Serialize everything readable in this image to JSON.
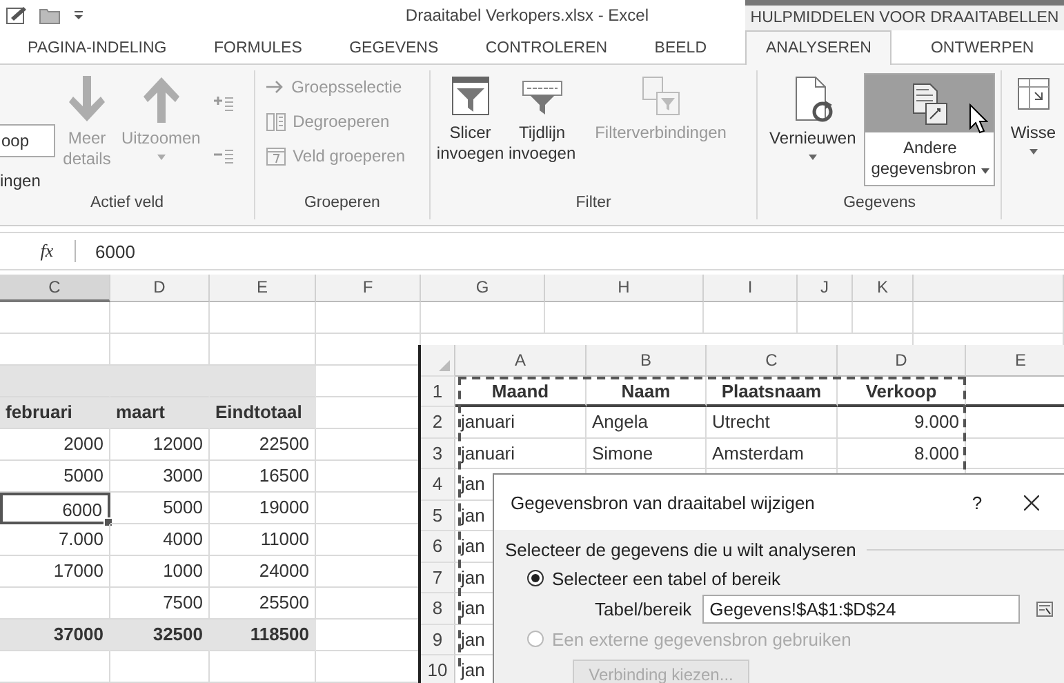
{
  "title_bar": {
    "title": "Draaitabel Verkopers.xlsx - Excel"
  },
  "tabs": [
    {
      "label": "PAGINA-INDELING",
      "selected": false
    },
    {
      "label": "FORMULES",
      "selected": false
    },
    {
      "label": "GEGEVENS",
      "selected": false
    },
    {
      "label": "CONTROLEREN",
      "selected": false
    },
    {
      "label": "BEELD",
      "selected": false
    }
  ],
  "context_tab_group": {
    "title": "HULPMIDDELEN VOOR DRAAITABELLEN",
    "tabs": [
      {
        "label": "ANALYSEREN",
        "selected": true
      },
      {
        "label": "ONTWERPEN",
        "selected": false
      }
    ]
  },
  "ribbon": {
    "active_field": {
      "label": "Actief veld",
      "field_value": "oop",
      "caption": "ingen",
      "drill_down": {
        "label": "Meer details",
        "disabled": true
      },
      "drill_up": {
        "label": "Uitzoomen",
        "disabled": true
      }
    },
    "group": {
      "label": "Groeperen",
      "items": [
        {
          "label": "Groepsselectie",
          "disabled": true
        },
        {
          "label": "Degroeperen",
          "disabled": true
        },
        {
          "label": "Veld groeperen",
          "disabled": true
        }
      ]
    },
    "filter": {
      "label": "Filter",
      "commands": [
        {
          "label": "Slicer invoegen",
          "disabled": false
        },
        {
          "label": "Tijdlijn invoegen",
          "disabled": false
        },
        {
          "label": "Filterverbindingen",
          "disabled": true
        }
      ]
    },
    "data": {
      "label": "Gegevens",
      "refresh": {
        "label": "Vernieuwen"
      },
      "change_source": {
        "label": "Andere gegevensbron",
        "hovered": true
      }
    },
    "clear": {
      "label": "Wisse"
    }
  },
  "formula_bar": {
    "function_label": "fx",
    "value": "6000"
  },
  "sheet": {
    "columns": [
      {
        "label": "C",
        "selected": true
      },
      {
        "label": "D",
        "selected": false
      },
      {
        "label": "E",
        "selected": false
      },
      {
        "label": "F",
        "selected": false
      },
      {
        "label": "G",
        "selected": false
      },
      {
        "label": "H",
        "selected": false
      },
      {
        "label": "I",
        "selected": false
      },
      {
        "label": "J",
        "selected": false
      },
      {
        "label": "K",
        "selected": false
      }
    ],
    "rows": [
      {
        "kind": "blank"
      },
      {
        "kind": "blank"
      },
      {
        "kind": "band"
      },
      {
        "kind": "header",
        "cells": [
          {
            "text": "februari",
            "selected": false
          },
          {
            "text": "maart",
            "selected": false
          },
          {
            "text": "Eindtotaal",
            "selected": false
          }
        ]
      },
      {
        "kind": "data",
        "cells": [
          {
            "text": "2000",
            "selected": false
          },
          {
            "text": "12000",
            "selected": false
          },
          {
            "text": "22500",
            "selected": false
          }
        ]
      },
      {
        "kind": "data",
        "cells": [
          {
            "text": "5000",
            "selected": false
          },
          {
            "text": "3000",
            "selected": false
          },
          {
            "text": "16500",
            "selected": false
          }
        ]
      },
      {
        "kind": "data",
        "cells": [
          {
            "text": "6000",
            "selected": true
          },
          {
            "text": "5000",
            "selected": false
          },
          {
            "text": "19000",
            "selected": false
          }
        ]
      },
      {
        "kind": "data",
        "cells": [
          {
            "text": "7.000",
            "selected": false
          },
          {
            "text": "4000",
            "selected": false
          },
          {
            "text": "11000",
            "selected": false
          }
        ]
      },
      {
        "kind": "data",
        "cells": [
          {
            "text": "17000",
            "selected": false
          },
          {
            "text": "1000",
            "selected": false
          },
          {
            "text": "24000",
            "selected": false
          }
        ]
      },
      {
        "kind": "data",
        "cells": [
          {
            "selected": false
          },
          {
            "text": "7500",
            "selected": false
          },
          {
            "text": "25500",
            "selected": false
          }
        ]
      },
      {
        "kind": "total",
        "cells": [
          {
            "text": "37000",
            "selected": false
          },
          {
            "text": "32500",
            "selected": false
          },
          {
            "text": "118500",
            "selected": false
          }
        ]
      },
      {
        "kind": "blank"
      }
    ]
  },
  "source_sheet": {
    "columns": [
      "A",
      "B",
      "C",
      "D",
      "E"
    ],
    "rows": [
      {
        "number": "1",
        "kind": "header",
        "cells": [
          "Maand",
          "Naam",
          "Plaatsnaam",
          "Verkoop"
        ]
      },
      {
        "number": "2",
        "kind": "data",
        "cells": [
          "januari",
          "Angela",
          "Utrecht",
          "9.000"
        ]
      },
      {
        "number": "3",
        "kind": "data",
        "cells": [
          "januari",
          "Simone",
          "Amsterdam",
          "8.000"
        ]
      },
      {
        "number": "4",
        "kind": "data",
        "cells": [
          "jan"
        ]
      },
      {
        "number": "5",
        "kind": "data",
        "cells": [
          "jan"
        ]
      },
      {
        "number": "6",
        "kind": "data",
        "cells": [
          "jan"
        ]
      },
      {
        "number": "7",
        "kind": "data",
        "cells": [
          "jan"
        ]
      },
      {
        "number": "8",
        "kind": "data",
        "cells": [
          "jan"
        ]
      },
      {
        "number": "9",
        "kind": "data",
        "cells": [
          "jan"
        ]
      },
      {
        "number": "10",
        "kind": "data",
        "cells": [
          "jan"
        ]
      }
    ]
  },
  "dialog": {
    "title": "Gegevensbron van draaitabel wijzigen",
    "help": "?",
    "section": "Selecteer de gegevens die u wilt analyseren",
    "options": [
      {
        "label": "Selecteer een tabel of bereik",
        "selected": true,
        "disabled": false
      },
      {
        "label": "Een externe gegevensbron gebruiken",
        "selected": false,
        "disabled": true
      }
    ],
    "range_label": "Tabel/bereik",
    "range_value": "Gegevens!$A$1:$D$24",
    "connection_button": {
      "label": "Verbinding kiezen...",
      "disabled": true
    }
  }
}
